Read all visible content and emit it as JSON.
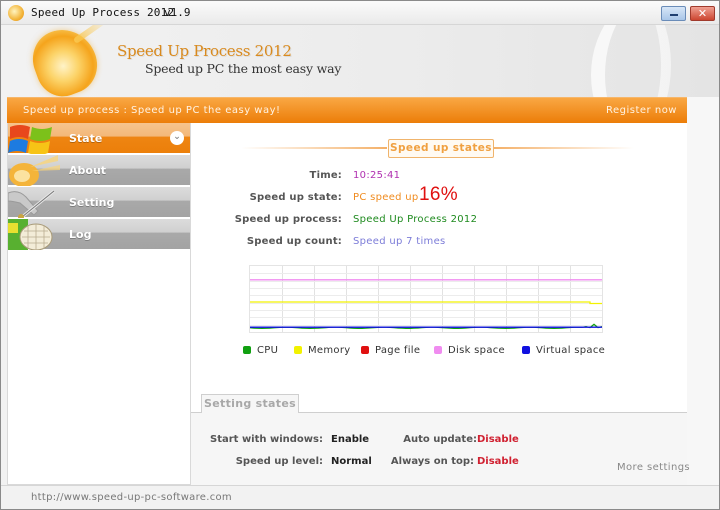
{
  "window": {
    "title": "Speed Up Process 2012",
    "version": "v1.9",
    "minimize_label": "minimize",
    "close_label": "✕"
  },
  "banner": {
    "title": "Speed Up Process 2012",
    "subtitle": "Speed up PC the most easy way"
  },
  "strip": {
    "tagline": "Speed up process : Speed up PC the easy way!",
    "register": "Register now"
  },
  "sidebar": {
    "items": [
      {
        "label": "State",
        "icon": "windows-flag-icon",
        "active": true
      },
      {
        "label": "About",
        "icon": "logo-flame-icon",
        "active": false
      },
      {
        "label": "Setting",
        "icon": "wrench-tool-icon",
        "active": false
      },
      {
        "label": "Log",
        "icon": "log-globe-icon",
        "active": false
      }
    ],
    "expand_glyph": "⌄"
  },
  "speed_up_states": {
    "section_title": "Speed up states",
    "rows": [
      {
        "label": "Time:",
        "value": "10:25:41"
      },
      {
        "label": "Speed up state:",
        "value": "PC speed up",
        "percent": "16%"
      },
      {
        "label": "Speed up process:",
        "value": "Speed Up Process 2012"
      },
      {
        "label": "Speed up count:",
        "value": "Speed up 7 times"
      }
    ]
  },
  "graph": {
    "legend": [
      {
        "name": "CPU",
        "color": "#10a010"
      },
      {
        "name": "Memory",
        "color": "#f2f200"
      },
      {
        "name": "Page file",
        "color": "#e01010"
      },
      {
        "name": "Disk space",
        "color": "#f08cf0"
      },
      {
        "name": "Virtual space",
        "color": "#1010e0"
      }
    ],
    "series_level_percent": {
      "Disk space": 82,
      "Memory": 45,
      "Virtual space": 3,
      "CPU": 2,
      "Page file": 0
    }
  },
  "setting_states": {
    "tab_label": "Setting states",
    "start_with_windows": {
      "label": "Start with windows:",
      "value": "Enable"
    },
    "speed_up_level": {
      "label": "Speed up level:",
      "value": "Normal"
    },
    "auto_update": {
      "label": "Auto update:",
      "value": "Disable"
    },
    "always_on_top": {
      "label": "Always on top:",
      "value": "Disable"
    },
    "more_settings": "More settings"
  },
  "footer": {
    "url": "http://www.speed-up-pc-software.com"
  }
}
